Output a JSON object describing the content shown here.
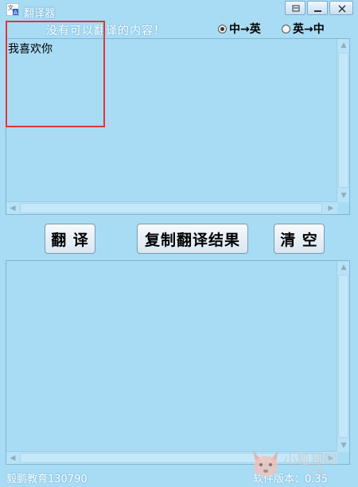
{
  "window": {
    "title": "翻译器",
    "buttons": {
      "restore": "restore",
      "minimize": "minimize",
      "close": "close"
    }
  },
  "status": {
    "message": "没有可以翻译的内容！"
  },
  "direction": {
    "options": [
      {
        "label": "中→英",
        "checked": true
      },
      {
        "label": "英→中",
        "checked": false
      }
    ]
  },
  "input": {
    "value": "我喜欢你"
  },
  "output": {
    "value": ""
  },
  "actions": {
    "translate_label": "翻 译",
    "copy_label": "复制翻译结果",
    "clear_label": "清 空"
  },
  "footer": {
    "left": "毅鹏教育130790",
    "right": "软件版本：0.35"
  },
  "watermark": {
    "text": "小狐狸网",
    "sub": "CN"
  },
  "colors": {
    "background": "#a8dcf4",
    "highlight": "#e0353a"
  }
}
